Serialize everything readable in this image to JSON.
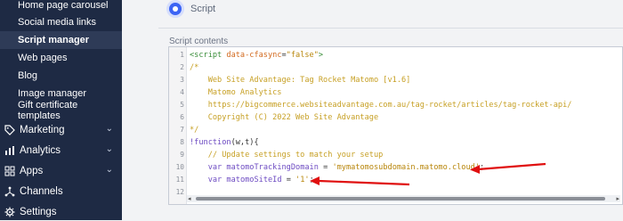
{
  "sidebar": {
    "sub_items": [
      {
        "label": "Home page carousel"
      },
      {
        "label": "Social media links"
      },
      {
        "label": "Script manager"
      },
      {
        "label": "Web pages"
      },
      {
        "label": "Blog"
      },
      {
        "label": "Image manager"
      },
      {
        "label": "Gift certificate templates"
      }
    ],
    "main_items": [
      {
        "label": "Marketing",
        "icon": "tag-icon"
      },
      {
        "label": "Analytics",
        "icon": "bar-chart-icon"
      },
      {
        "label": "Apps",
        "icon": "apps-grid-icon"
      },
      {
        "label": "Channels",
        "icon": "share-nodes-icon"
      },
      {
        "label": "Settings",
        "icon": "gear-icon"
      }
    ]
  },
  "form": {
    "radio_label": "Script",
    "section_label": "Script contents"
  },
  "editor": {
    "line_numbers": [
      "1",
      "2",
      "3",
      "4",
      "5",
      "6",
      "7",
      "8",
      "9",
      "10",
      "11",
      "12"
    ]
  },
  "colors": {
    "sidebar_bg": "#1e2a44",
    "accent_blue": "#3c64f4",
    "annotation_red": "#e01010"
  }
}
